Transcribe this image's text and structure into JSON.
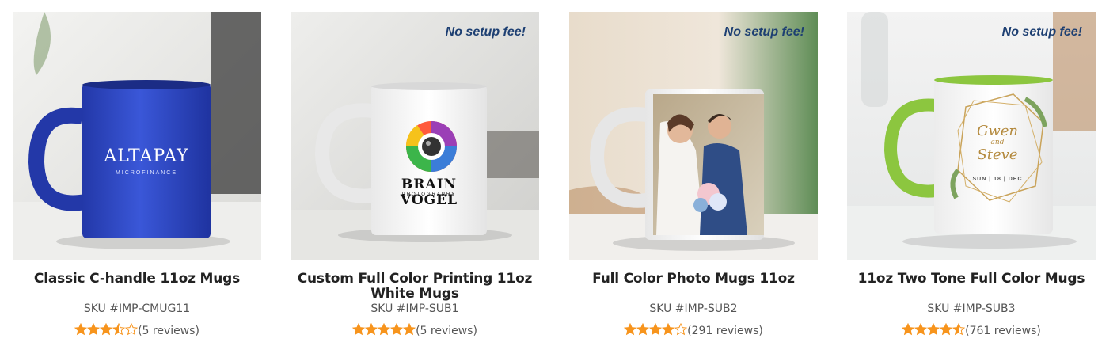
{
  "products": [
    {
      "title": "Classic C-handle 11oz Mugs",
      "sku": "SKU #IMP-CMUG11",
      "rating": 3.5,
      "reviews": "(5 reviews)",
      "badge": "",
      "print_brand": "ALTAPAY",
      "print_sub": "MICROFINANCE",
      "mug_color": "#2d48c9"
    },
    {
      "title": "Custom Full Color Printing 11oz White Mugs",
      "sku": "SKU #IMP-SUB1",
      "rating": 5,
      "reviews": "(5 reviews)",
      "badge": "No setup fee!",
      "print_brand": "BRAIN VOGEL",
      "print_sub": "PHOTOGRAPHY",
      "mug_color": "#ffffff"
    },
    {
      "title": "Full Color Photo Mugs 11oz",
      "sku": "SKU #IMP-SUB2",
      "rating": 4,
      "reviews": "(291 reviews)",
      "badge": "No setup fee!",
      "mug_color": "#ffffff"
    },
    {
      "title": "11oz Two Tone Full Color Mugs",
      "sku": "SKU #IMP-SUB3",
      "rating": 4.5,
      "reviews": "(761 reviews)",
      "badge": "No setup fee!",
      "print_line1": "Gwen",
      "print_line2": "and",
      "print_line3": "Steve",
      "print_date": "SUN | 18 | DEC",
      "mug_color": "#ffffff",
      "accent_color": "#8cc63f"
    }
  ],
  "colors": {
    "star": "#f7941d",
    "badge": "#1d3f72"
  }
}
